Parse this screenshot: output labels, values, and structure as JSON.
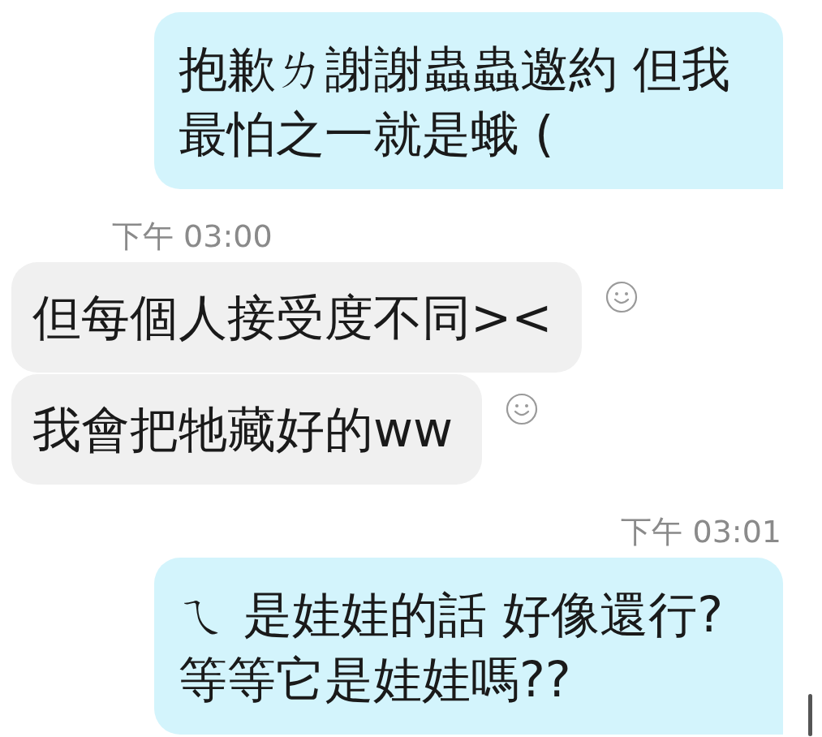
{
  "messages": [
    {
      "kind": "sent",
      "text": "抱歉ㄌ謝謝蟲蟲邀約 但我最怕之一就是蛾 (",
      "reaction": false
    },
    {
      "kind": "received_time",
      "text": "下午 03:00"
    },
    {
      "kind": "received",
      "text": "但每個人接受度不同><",
      "reaction": true
    },
    {
      "kind": "received",
      "text": "我會把牠藏好的ww",
      "reaction": true
    },
    {
      "kind": "sent_time",
      "text": "下午 03:01"
    },
    {
      "kind": "sent",
      "text": "ㄟ 是娃娃的話 好像還行?等等它是娃娃嗎??",
      "reaction": false
    }
  ]
}
